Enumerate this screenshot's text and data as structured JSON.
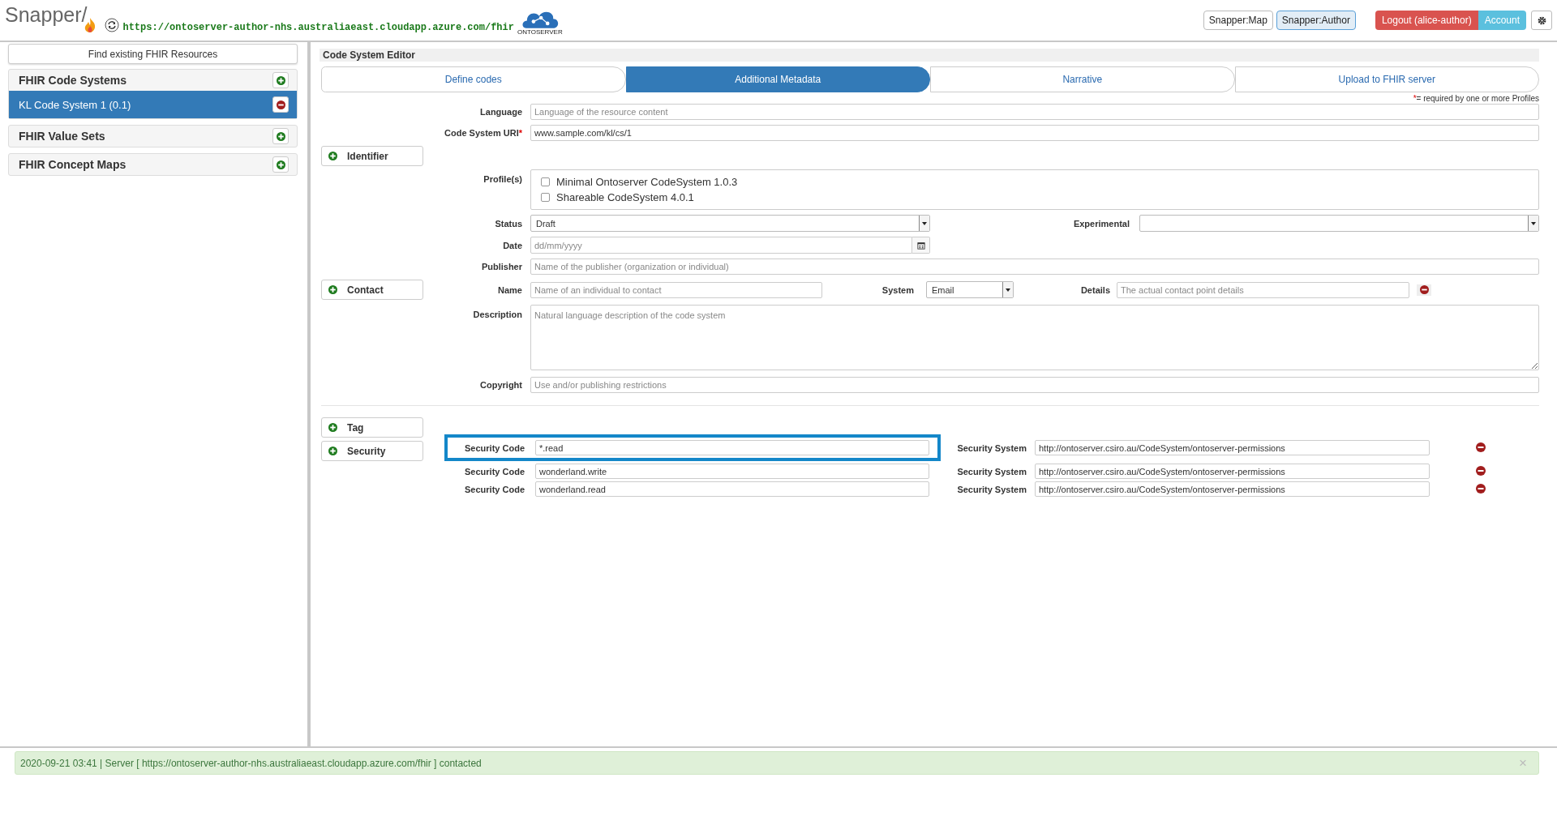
{
  "header": {
    "brand": "Snapper/",
    "url": "https://ontoserver-author-nhs.australiaeast.cloudapp.azure.com/fhir",
    "logo_caption": "ONTOSERVER",
    "nav_buttons": [
      {
        "label": "Snapper:Map",
        "selected": false
      },
      {
        "label": "Snapper:Author",
        "selected": true
      }
    ],
    "logout": "Logout (alice-author)",
    "account": "Account"
  },
  "sidebar": {
    "find_button": "Find existing FHIR Resources",
    "sections": [
      {
        "title": "FHIR Code Systems",
        "items": [
          {
            "label": "KL Code System 1 (0.1)",
            "selected": true
          }
        ]
      },
      {
        "title": "FHIR Value Sets"
      },
      {
        "title": "FHIR Concept Maps"
      }
    ]
  },
  "editor": {
    "title": "Code System Editor",
    "tabs": [
      {
        "label": "Define codes",
        "selected": false
      },
      {
        "label": "Additional Metadata",
        "selected": true
      },
      {
        "label": "Narrative",
        "selected": false
      },
      {
        "label": "Upload to FHIR server",
        "selected": false
      }
    ],
    "required_note": {
      "mark": "*",
      "text": "= required by one or more Profiles"
    },
    "language": {
      "label": "Language",
      "placeholder": "Language of the resource content"
    },
    "uri": {
      "label": "Code System URI",
      "required_mark": "*",
      "value": "www.sample.com/kl/cs/1"
    },
    "identifier_button": "Identifier",
    "profiles": {
      "label": "Profile(s)",
      "options": [
        {
          "label": "Minimal Ontoserver CodeSystem 1.0.3",
          "checked": false
        },
        {
          "label": "Shareable CodeSystem 4.0.1",
          "checked": false
        }
      ]
    },
    "status": {
      "label": "Status",
      "value": "Draft"
    },
    "experimental": {
      "label": "Experimental"
    },
    "date": {
      "label": "Date",
      "placeholder": "dd/mm/yyyy"
    },
    "publisher": {
      "label": "Publisher",
      "placeholder": "Name of the publisher (organization or individual)"
    },
    "contact": {
      "button": "Contact",
      "name": {
        "label": "Name",
        "placeholder": "Name of an individual to contact"
      },
      "system": {
        "label": "System",
        "value": "Email"
      },
      "details": {
        "label": "Details",
        "placeholder": "The actual contact point details"
      }
    },
    "description": {
      "label": "Description",
      "placeholder": "Natural language description of the code system"
    },
    "copyright": {
      "label": "Copyright",
      "placeholder": "Use and/or publishing restrictions"
    },
    "tag_button": "Tag",
    "security": {
      "button": "Security",
      "rows": [
        {
          "code_label": "Security Code",
          "code": "*.read",
          "system_label": "Security System",
          "system": "http://ontoserver.csiro.au/CodeSystem/ontoserver-permissions",
          "highlighted": true
        },
        {
          "code_label": "Security Code",
          "code": "wonderland.write",
          "system_label": "Security System",
          "system": "http://ontoserver.csiro.au/CodeSystem/ontoserver-permissions",
          "highlighted": false
        },
        {
          "code_label": "Security Code",
          "code": "wonderland.read",
          "system_label": "Security System",
          "system": "http://ontoserver.csiro.au/CodeSystem/ontoserver-permissions",
          "highlighted": false
        }
      ]
    }
  },
  "status_bar": {
    "message": "2020-09-21 03:41 | Server [ https://ontoserver-author-nhs.australiaeast.cloudapp.azure.com/fhir ] contacted",
    "close": "×"
  }
}
